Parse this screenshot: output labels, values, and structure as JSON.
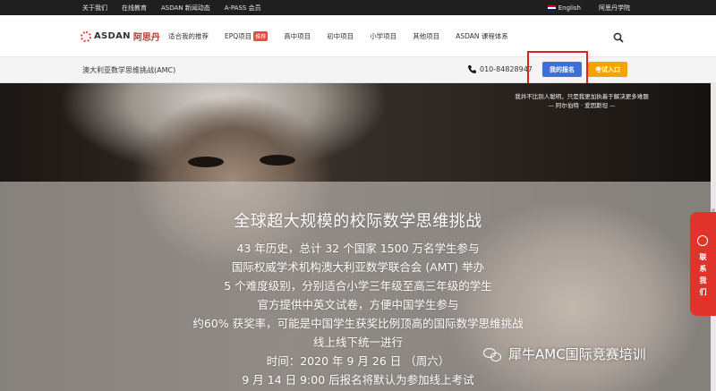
{
  "topbar": {
    "links": [
      "关于我们",
      "在线教育",
      "ASDAN 新闻动态",
      "A-PASS 会员"
    ],
    "language": "English",
    "school": "阿思丹学院"
  },
  "nav": {
    "logo_text": "ASDAN",
    "logo_cn": "阿思丹",
    "items": [
      "适合我的推荐",
      "EPQ项目",
      "高中项目",
      "初中项目",
      "小学项目",
      "其他项目",
      "ASDAN 课程体系"
    ],
    "hot_badge": "推荐"
  },
  "subbar": {
    "title": "澳大利亚数学思维挑战(AMC)",
    "phone": "010-84828947",
    "register_label": "我的报名",
    "exam_label": "考试入口"
  },
  "hero": {
    "quote_line1": "我并不比别人聪明，只是我更加执着于解决更多难题",
    "quote_line2": "— 阿尔伯特 · 爱因斯坦 —",
    "heading": "全球超大规模的校际数学思维挑战",
    "lines": [
      "43 年历史，总计 32 个国家 1500 万名学生参与",
      "国际权威学术机构澳大利亚数学联合会 (AMT) 举办",
      "5 个难度级别，分别适合小学三年级至高三年级的学生",
      "官方提供中英文试卷，方便中国学生参与",
      "约60% 获奖率，可能是中国学生获奖比例顶高的国际数学思维挑战",
      "线上线下统一进行",
      "时间：2020 年 9 月 26 日 （周六）",
      "9 月 14 日 9:00 后报名将默认为参加线上考试"
    ]
  },
  "side_contact": {
    "label": "联系我们",
    "chars": [
      "联",
      "系",
      "我",
      "们"
    ]
  },
  "watermark": {
    "text": "犀牛AMC国际竞赛培训"
  },
  "colors": {
    "register": "#3b6fd9",
    "exam": "#f5a300",
    "side": "#e0332a",
    "highlight": "#e02020"
  }
}
